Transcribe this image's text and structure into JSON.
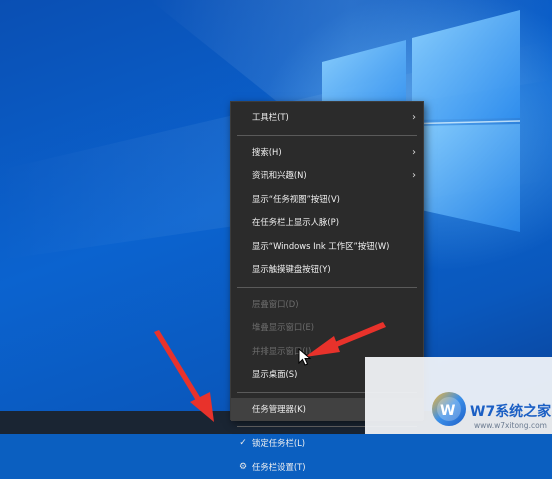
{
  "desktop": {
    "wallpaper": "windows-10-hero",
    "accent": "#0b63cf"
  },
  "context_menu": {
    "groups": [
      [
        {
          "label": "工具栏(T)",
          "submenu": true,
          "enabled": true
        }
      ],
      [
        {
          "label": "搜索(H)",
          "submenu": true,
          "enabled": true
        },
        {
          "label": "资讯和兴趣(N)",
          "submenu": true,
          "enabled": true
        },
        {
          "label": "显示“任务视图”按钮(V)",
          "submenu": false,
          "enabled": true
        },
        {
          "label": "在任务栏上显示人脉(P)",
          "submenu": false,
          "enabled": true
        },
        {
          "label": "显示“Windows Ink 工作区”按钮(W)",
          "submenu": false,
          "enabled": true
        },
        {
          "label": "显示触摸键盘按钮(Y)",
          "submenu": false,
          "enabled": true
        }
      ],
      [
        {
          "label": "层叠窗口(D)",
          "submenu": false,
          "enabled": false
        },
        {
          "label": "堆叠显示窗口(E)",
          "submenu": false,
          "enabled": false
        },
        {
          "label": "并排显示窗口(I)",
          "submenu": false,
          "enabled": false
        },
        {
          "label": "显示桌面(S)",
          "submenu": false,
          "enabled": true
        }
      ],
      [
        {
          "label": "任务管理器(K)",
          "submenu": false,
          "enabled": true,
          "highlighted": true
        }
      ],
      [
        {
          "label": "锁定任务栏(L)",
          "submenu": false,
          "enabled": true,
          "checked": true
        },
        {
          "label": "任务栏设置(T)",
          "submenu": false,
          "enabled": true,
          "icon": "gear-icon"
        }
      ]
    ]
  },
  "icons": {
    "submenu": "chevron-right-icon",
    "check": "checkmark-icon",
    "settings": "gear-icon"
  },
  "annotations": {
    "arrow_color": "#e8322b"
  },
  "watermark": {
    "brand": "W7系统之家",
    "url": "www.w7xitong.com",
    "color": "#1b5fc4"
  }
}
